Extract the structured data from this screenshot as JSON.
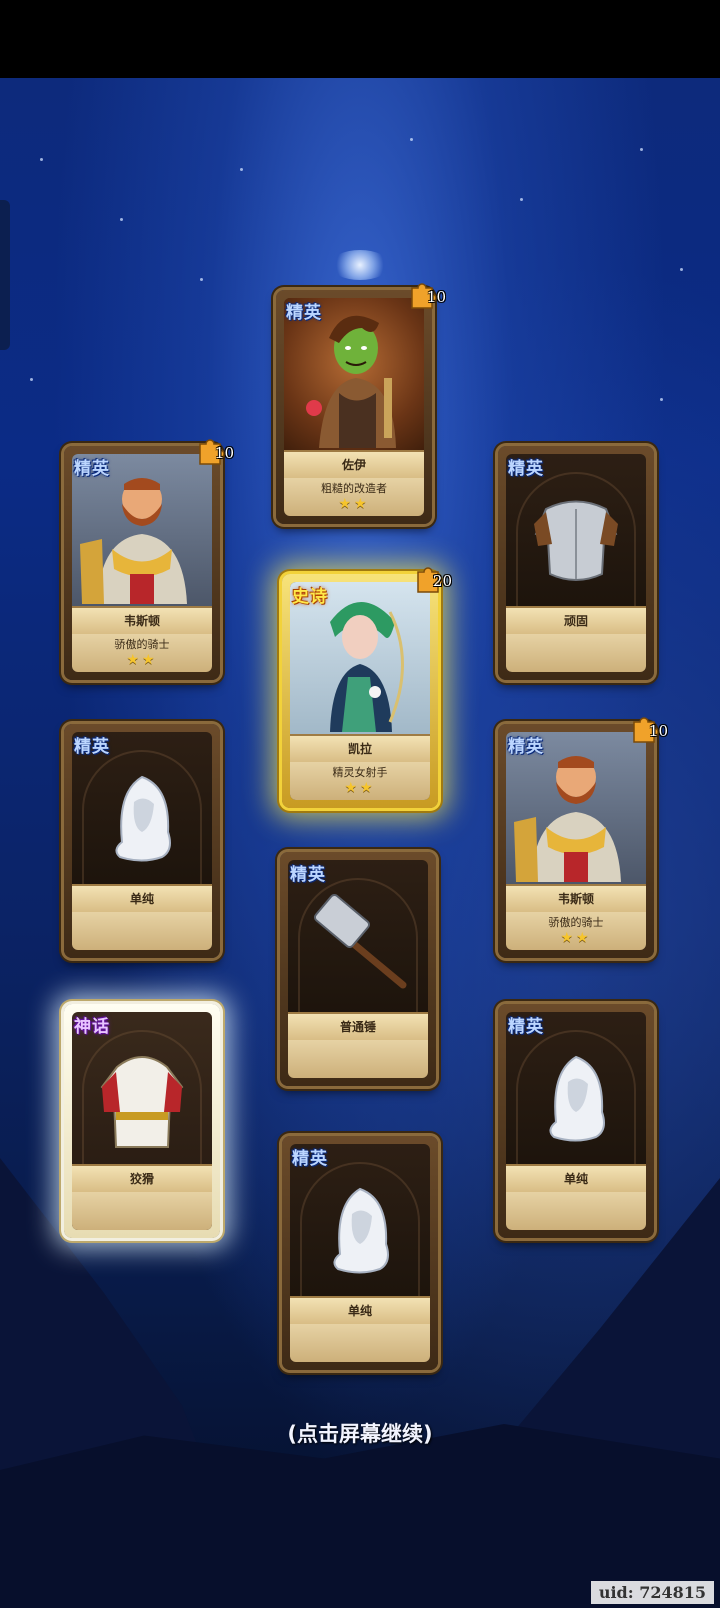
{
  "cards": [
    {
      "rarity": "精英",
      "name": "佐伊",
      "desc": "粗糙的改造者",
      "stars": "★★",
      "fragments": "10"
    },
    {
      "rarity": "精英",
      "name": "韦斯顿",
      "desc": "骄傲的骑士",
      "stars": "★★",
      "fragments": "10"
    },
    {
      "rarity": "精英",
      "name": "顽固",
      "desc": "",
      "stars": "",
      "fragments": ""
    },
    {
      "rarity": "史诗",
      "name": "凯拉",
      "desc": "精灵女射手",
      "stars": "★★",
      "fragments": "20"
    },
    {
      "rarity": "精英",
      "name": "单纯",
      "desc": "",
      "stars": "",
      "fragments": ""
    },
    {
      "rarity": "精英",
      "name": "韦斯顿",
      "desc": "骄傲的骑士",
      "stars": "★★",
      "fragments": "10"
    },
    {
      "rarity": "精英",
      "name": "普通锤",
      "desc": "",
      "stars": "",
      "fragments": ""
    },
    {
      "rarity": "神话",
      "name": "狡猾",
      "desc": "",
      "stars": "",
      "fragments": ""
    },
    {
      "rarity": "精英",
      "name": "单纯",
      "desc": "",
      "stars": "",
      "fragments": ""
    },
    {
      "rarity": "精英",
      "name": "单纯",
      "desc": "",
      "stars": "",
      "fragments": ""
    }
  ],
  "continue_prompt": "(点击屏幕继续)",
  "uid_label": "uid: 724815",
  "colors": {
    "elite": "#bcd6ff",
    "epic": "#ffe84a",
    "myth": "#e8c4ff",
    "star": "#f6c52c"
  }
}
